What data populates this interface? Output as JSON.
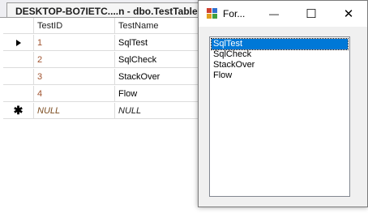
{
  "document": {
    "tab_title": "DESKTOP-BO7IETC....n - dbo.TestTable"
  },
  "table": {
    "columns": [
      "TestID",
      "TestName"
    ],
    "rows": [
      {
        "id": "1",
        "name": "SqlTest",
        "indicator": "current"
      },
      {
        "id": "2",
        "name": "SqlCheck",
        "indicator": ""
      },
      {
        "id": "3",
        "name": "StackOver",
        "indicator": ""
      },
      {
        "id": "4",
        "name": "Flow",
        "indicator": ""
      },
      {
        "id": "NULL",
        "name": "NULL",
        "indicator": "new"
      }
    ],
    "new_row_glyph": "✱"
  },
  "form": {
    "title": "For...",
    "minimize_glyph": "—",
    "maximize_glyph": "☐",
    "close_glyph": "✕",
    "listbox_items": [
      "SqlTest",
      "SqlCheck",
      "StackOver",
      "Flow"
    ],
    "selected_index": 0
  }
}
